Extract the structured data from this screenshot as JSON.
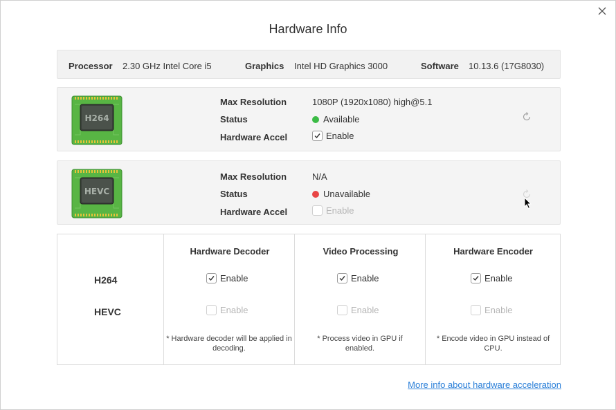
{
  "window": {
    "title": "Hardware Info"
  },
  "system": {
    "processor_label": "Processor",
    "processor_value": "2.30 GHz Intel Core i5",
    "graphics_label": "Graphics",
    "graphics_value": "Intel HD Graphics 3000",
    "software_label": "Software",
    "software_value": "10.13.6 (17G8030)"
  },
  "codecs": [
    {
      "chip_label": "H264",
      "max_res_label": "Max Resolution",
      "max_res_value": "1080P (1920x1080) high@5.1",
      "status_label": "Status",
      "status_value": "Available",
      "status_color": "#3bbb45",
      "accel_label": "Hardware Accel",
      "accel_option": "Enable",
      "accel_checked": true
    },
    {
      "chip_label": "HEVC",
      "max_res_label": "Max Resolution",
      "max_res_value": "N/A",
      "status_label": "Status",
      "status_value": "Unavailable",
      "status_color": "#e84545",
      "accel_label": "Hardware Accel",
      "accel_option": "Enable",
      "accel_checked": false
    }
  ],
  "matrix": {
    "columns": [
      "Hardware Decoder",
      "Video Processing",
      "Hardware Encoder"
    ],
    "rows": [
      "H264",
      "HEVC"
    ],
    "option_label": "Enable",
    "notes": [
      "* Hardware decoder will be applied in decoding.",
      "* Process video in GPU if enabled.",
      "* Encode video in GPU instead of CPU."
    ]
  },
  "footer": {
    "link": "More info about hardware acceleration"
  },
  "colors": {
    "accent_link": "#2a7fd8",
    "chip_green": "#4caf3a"
  }
}
